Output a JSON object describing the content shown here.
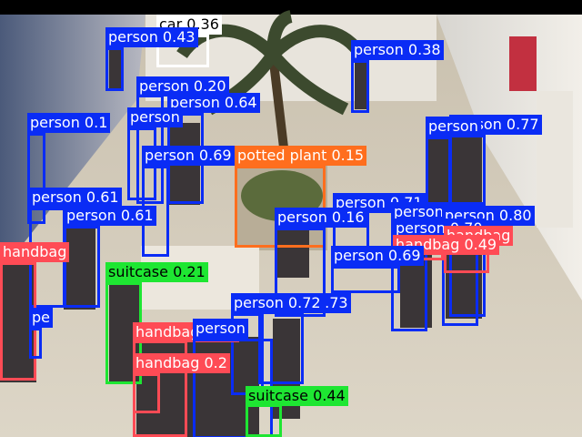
{
  "image": {
    "description_colors": {
      "top_bar": "#000000",
      "floor": "#cfc6b4",
      "walls": "#d9d6cf",
      "palm": "#3c4a2e"
    }
  },
  "classes": {
    "person": {
      "color": "#0a2cf5",
      "text_color": "#ffffff"
    },
    "car": {
      "color": "#ffffff",
      "text_color": "#000000"
    },
    "potted_plant": {
      "color": "#ff6e1e",
      "text_color": "#ffffff"
    },
    "suitcase": {
      "color": "#1ee632",
      "text_color": "#000000"
    },
    "handbag": {
      "color": "#ff4b55",
      "text_color": "#ffffff"
    }
  },
  "detections": [
    {
      "label": "car 0.36",
      "cls": "car"
    },
    {
      "label": "person 0.43",
      "cls": "person"
    },
    {
      "label": "person 0.38",
      "cls": "person"
    },
    {
      "label": "person 0.20",
      "cls": "person"
    },
    {
      "label": "person 0.64",
      "cls": "person"
    },
    {
      "label": "person 0.1",
      "cls": "person"
    },
    {
      "label": "person",
      "cls": "person"
    },
    {
      "label": "person 0.61",
      "cls": "person"
    },
    {
      "label": "person 0.77",
      "cls": "person"
    },
    {
      "label": "person",
      "cls": "person"
    },
    {
      "label": "person 0.69",
      "cls": "person"
    },
    {
      "label": "potted plant 0.15",
      "cls": "potted_plant"
    },
    {
      "label": "person 0.61",
      "cls": "person"
    },
    {
      "label": "person 0.71",
      "cls": "person"
    },
    {
      "label": "person 0.16",
      "cls": "person"
    },
    {
      "label": "person 0.65",
      "cls": "person"
    },
    {
      "label": "person 0.80",
      "cls": "person"
    },
    {
      "label": "person 0.70",
      "cls": "person"
    },
    {
      "label": "handbag",
      "cls": "handbag"
    },
    {
      "label": "handbag 0.49",
      "cls": "handbag"
    },
    {
      "label": "handbag",
      "cls": "handbag"
    },
    {
      "label": "person 0.69",
      "cls": "person"
    },
    {
      "label": "suitcase 0.21",
      "cls": "suitcase"
    },
    {
      "label": "person 0.73",
      "cls": "person"
    },
    {
      "label": "person 0.72",
      "cls": "person"
    },
    {
      "label": "pe",
      "cls": "person"
    },
    {
      "label": "handbag 0.18",
      "cls": "handbag"
    },
    {
      "label": "person",
      "cls": "person"
    },
    {
      "label": "person 0.55",
      "cls": "person"
    },
    {
      "label": "handbag 0.2",
      "cls": "handbag"
    },
    {
      "label": "suitcase 0.44",
      "cls": "suitcase"
    }
  ]
}
